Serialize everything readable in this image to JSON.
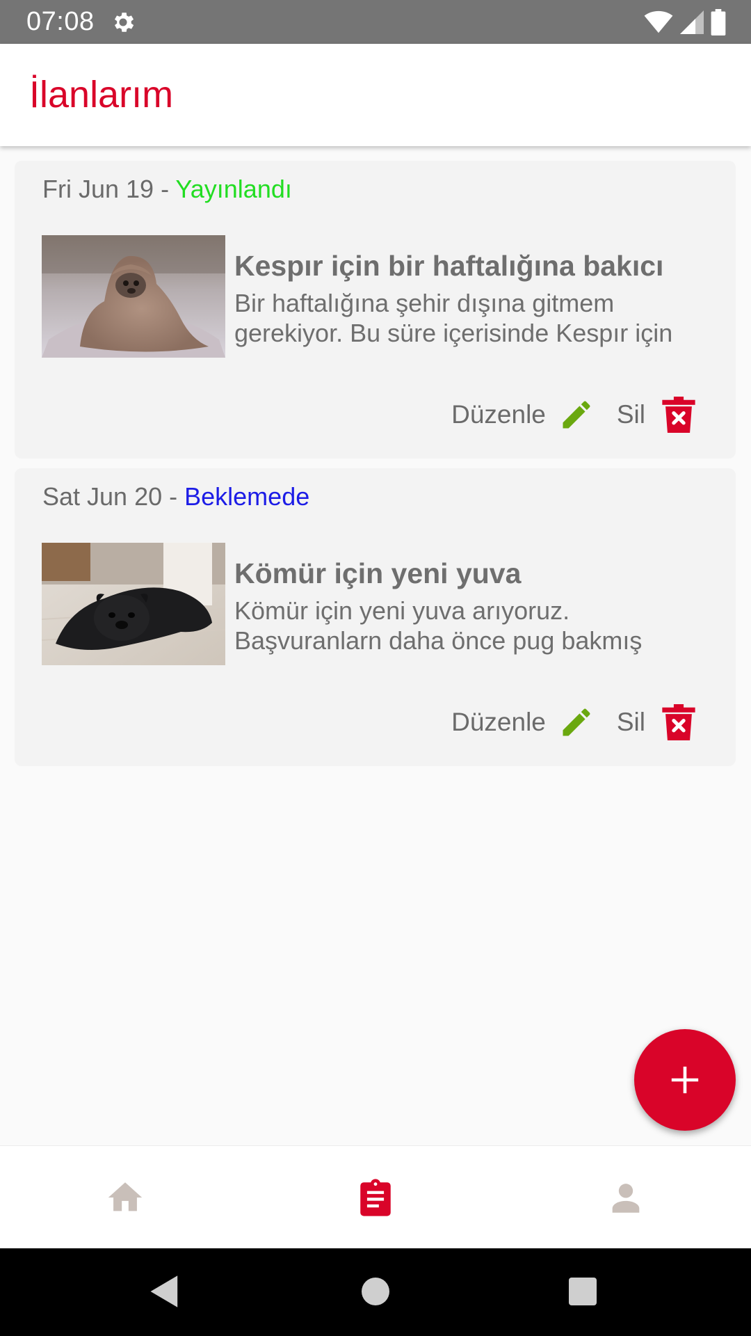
{
  "status_bar": {
    "time": "07:08",
    "icons": [
      "settings-icon",
      "wifi-icon",
      "cell-signal-icon",
      "battery-icon"
    ]
  },
  "app_bar": {
    "title": "İlanlarım"
  },
  "colors": {
    "accent": "#d90429",
    "published": "#22dd22",
    "pending": "#1c1ce6",
    "edit_icon": "#6aa80f",
    "nav_inactive": "#c9bfb9"
  },
  "listings": [
    {
      "date": "Fri Jun 19",
      "separator": " - ",
      "status": "Yayınlandı",
      "title": "Kespır için bir haftalığına bakıcı",
      "description": "Bir haftalığına şehir dışına gitmem gerekiyor. Bu süre içerisinde Kespır için",
      "edit_label": "Düzenle",
      "delete_label": "Sil"
    },
    {
      "date": "Sat Jun 20",
      "separator": " - ",
      "status": "Beklemede",
      "title": "Kömür için yeni yuva",
      "description": "Kömür için yeni yuva arıyoruz. Başvuranlarn  daha önce pug bakmış",
      "edit_label": "Düzenle",
      "delete_label": "Sil"
    }
  ],
  "fab": {
    "icon": "plus-icon"
  },
  "bottom_nav": {
    "items": [
      {
        "icon": "home-icon",
        "active": false
      },
      {
        "icon": "clipboard-list-icon",
        "active": true
      },
      {
        "icon": "person-icon",
        "active": false
      }
    ]
  },
  "system_nav": {
    "icons": [
      "back-icon",
      "home-circle-icon",
      "recents-icon"
    ]
  }
}
